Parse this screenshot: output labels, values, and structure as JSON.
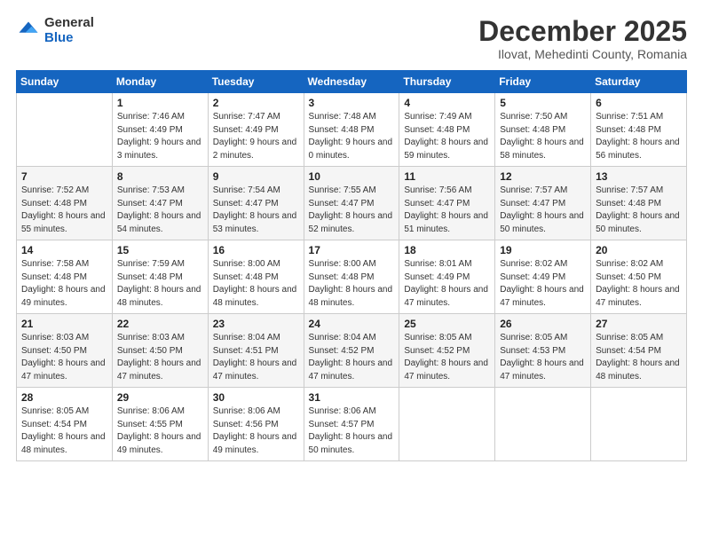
{
  "logo": {
    "general": "General",
    "blue": "Blue"
  },
  "header": {
    "month": "December 2025",
    "location": "Ilovat, Mehedinti County, Romania"
  },
  "weekdays": [
    "Sunday",
    "Monday",
    "Tuesday",
    "Wednesday",
    "Thursday",
    "Friday",
    "Saturday"
  ],
  "weeks": [
    [
      {
        "day": "",
        "sunrise": "",
        "sunset": "",
        "daylight": ""
      },
      {
        "day": "1",
        "sunrise": "Sunrise: 7:46 AM",
        "sunset": "Sunset: 4:49 PM",
        "daylight": "Daylight: 9 hours and 3 minutes."
      },
      {
        "day": "2",
        "sunrise": "Sunrise: 7:47 AM",
        "sunset": "Sunset: 4:49 PM",
        "daylight": "Daylight: 9 hours and 2 minutes."
      },
      {
        "day": "3",
        "sunrise": "Sunrise: 7:48 AM",
        "sunset": "Sunset: 4:48 PM",
        "daylight": "Daylight: 9 hours and 0 minutes."
      },
      {
        "day": "4",
        "sunrise": "Sunrise: 7:49 AM",
        "sunset": "Sunset: 4:48 PM",
        "daylight": "Daylight: 8 hours and 59 minutes."
      },
      {
        "day": "5",
        "sunrise": "Sunrise: 7:50 AM",
        "sunset": "Sunset: 4:48 PM",
        "daylight": "Daylight: 8 hours and 58 minutes."
      },
      {
        "day": "6",
        "sunrise": "Sunrise: 7:51 AM",
        "sunset": "Sunset: 4:48 PM",
        "daylight": "Daylight: 8 hours and 56 minutes."
      }
    ],
    [
      {
        "day": "7",
        "sunrise": "Sunrise: 7:52 AM",
        "sunset": "Sunset: 4:48 PM",
        "daylight": "Daylight: 8 hours and 55 minutes."
      },
      {
        "day": "8",
        "sunrise": "Sunrise: 7:53 AM",
        "sunset": "Sunset: 4:47 PM",
        "daylight": "Daylight: 8 hours and 54 minutes."
      },
      {
        "day": "9",
        "sunrise": "Sunrise: 7:54 AM",
        "sunset": "Sunset: 4:47 PM",
        "daylight": "Daylight: 8 hours and 53 minutes."
      },
      {
        "day": "10",
        "sunrise": "Sunrise: 7:55 AM",
        "sunset": "Sunset: 4:47 PM",
        "daylight": "Daylight: 8 hours and 52 minutes."
      },
      {
        "day": "11",
        "sunrise": "Sunrise: 7:56 AM",
        "sunset": "Sunset: 4:47 PM",
        "daylight": "Daylight: 8 hours and 51 minutes."
      },
      {
        "day": "12",
        "sunrise": "Sunrise: 7:57 AM",
        "sunset": "Sunset: 4:47 PM",
        "daylight": "Daylight: 8 hours and 50 minutes."
      },
      {
        "day": "13",
        "sunrise": "Sunrise: 7:57 AM",
        "sunset": "Sunset: 4:48 PM",
        "daylight": "Daylight: 8 hours and 50 minutes."
      }
    ],
    [
      {
        "day": "14",
        "sunrise": "Sunrise: 7:58 AM",
        "sunset": "Sunset: 4:48 PM",
        "daylight": "Daylight: 8 hours and 49 minutes."
      },
      {
        "day": "15",
        "sunrise": "Sunrise: 7:59 AM",
        "sunset": "Sunset: 4:48 PM",
        "daylight": "Daylight: 8 hours and 48 minutes."
      },
      {
        "day": "16",
        "sunrise": "Sunrise: 8:00 AM",
        "sunset": "Sunset: 4:48 PM",
        "daylight": "Daylight: 8 hours and 48 minutes."
      },
      {
        "day": "17",
        "sunrise": "Sunrise: 8:00 AM",
        "sunset": "Sunset: 4:48 PM",
        "daylight": "Daylight: 8 hours and 48 minutes."
      },
      {
        "day": "18",
        "sunrise": "Sunrise: 8:01 AM",
        "sunset": "Sunset: 4:49 PM",
        "daylight": "Daylight: 8 hours and 47 minutes."
      },
      {
        "day": "19",
        "sunrise": "Sunrise: 8:02 AM",
        "sunset": "Sunset: 4:49 PM",
        "daylight": "Daylight: 8 hours and 47 minutes."
      },
      {
        "day": "20",
        "sunrise": "Sunrise: 8:02 AM",
        "sunset": "Sunset: 4:50 PM",
        "daylight": "Daylight: 8 hours and 47 minutes."
      }
    ],
    [
      {
        "day": "21",
        "sunrise": "Sunrise: 8:03 AM",
        "sunset": "Sunset: 4:50 PM",
        "daylight": "Daylight: 8 hours and 47 minutes."
      },
      {
        "day": "22",
        "sunrise": "Sunrise: 8:03 AM",
        "sunset": "Sunset: 4:50 PM",
        "daylight": "Daylight: 8 hours and 47 minutes."
      },
      {
        "day": "23",
        "sunrise": "Sunrise: 8:04 AM",
        "sunset": "Sunset: 4:51 PM",
        "daylight": "Daylight: 8 hours and 47 minutes."
      },
      {
        "day": "24",
        "sunrise": "Sunrise: 8:04 AM",
        "sunset": "Sunset: 4:52 PM",
        "daylight": "Daylight: 8 hours and 47 minutes."
      },
      {
        "day": "25",
        "sunrise": "Sunrise: 8:05 AM",
        "sunset": "Sunset: 4:52 PM",
        "daylight": "Daylight: 8 hours and 47 minutes."
      },
      {
        "day": "26",
        "sunrise": "Sunrise: 8:05 AM",
        "sunset": "Sunset: 4:53 PM",
        "daylight": "Daylight: 8 hours and 47 minutes."
      },
      {
        "day": "27",
        "sunrise": "Sunrise: 8:05 AM",
        "sunset": "Sunset: 4:54 PM",
        "daylight": "Daylight: 8 hours and 48 minutes."
      }
    ],
    [
      {
        "day": "28",
        "sunrise": "Sunrise: 8:05 AM",
        "sunset": "Sunset: 4:54 PM",
        "daylight": "Daylight: 8 hours and 48 minutes."
      },
      {
        "day": "29",
        "sunrise": "Sunrise: 8:06 AM",
        "sunset": "Sunset: 4:55 PM",
        "daylight": "Daylight: 8 hours and 49 minutes."
      },
      {
        "day": "30",
        "sunrise": "Sunrise: 8:06 AM",
        "sunset": "Sunset: 4:56 PM",
        "daylight": "Daylight: 8 hours and 49 minutes."
      },
      {
        "day": "31",
        "sunrise": "Sunrise: 8:06 AM",
        "sunset": "Sunset: 4:57 PM",
        "daylight": "Daylight: 8 hours and 50 minutes."
      },
      {
        "day": "",
        "sunrise": "",
        "sunset": "",
        "daylight": ""
      },
      {
        "day": "",
        "sunrise": "",
        "sunset": "",
        "daylight": ""
      },
      {
        "day": "",
        "sunrise": "",
        "sunset": "",
        "daylight": ""
      }
    ]
  ]
}
